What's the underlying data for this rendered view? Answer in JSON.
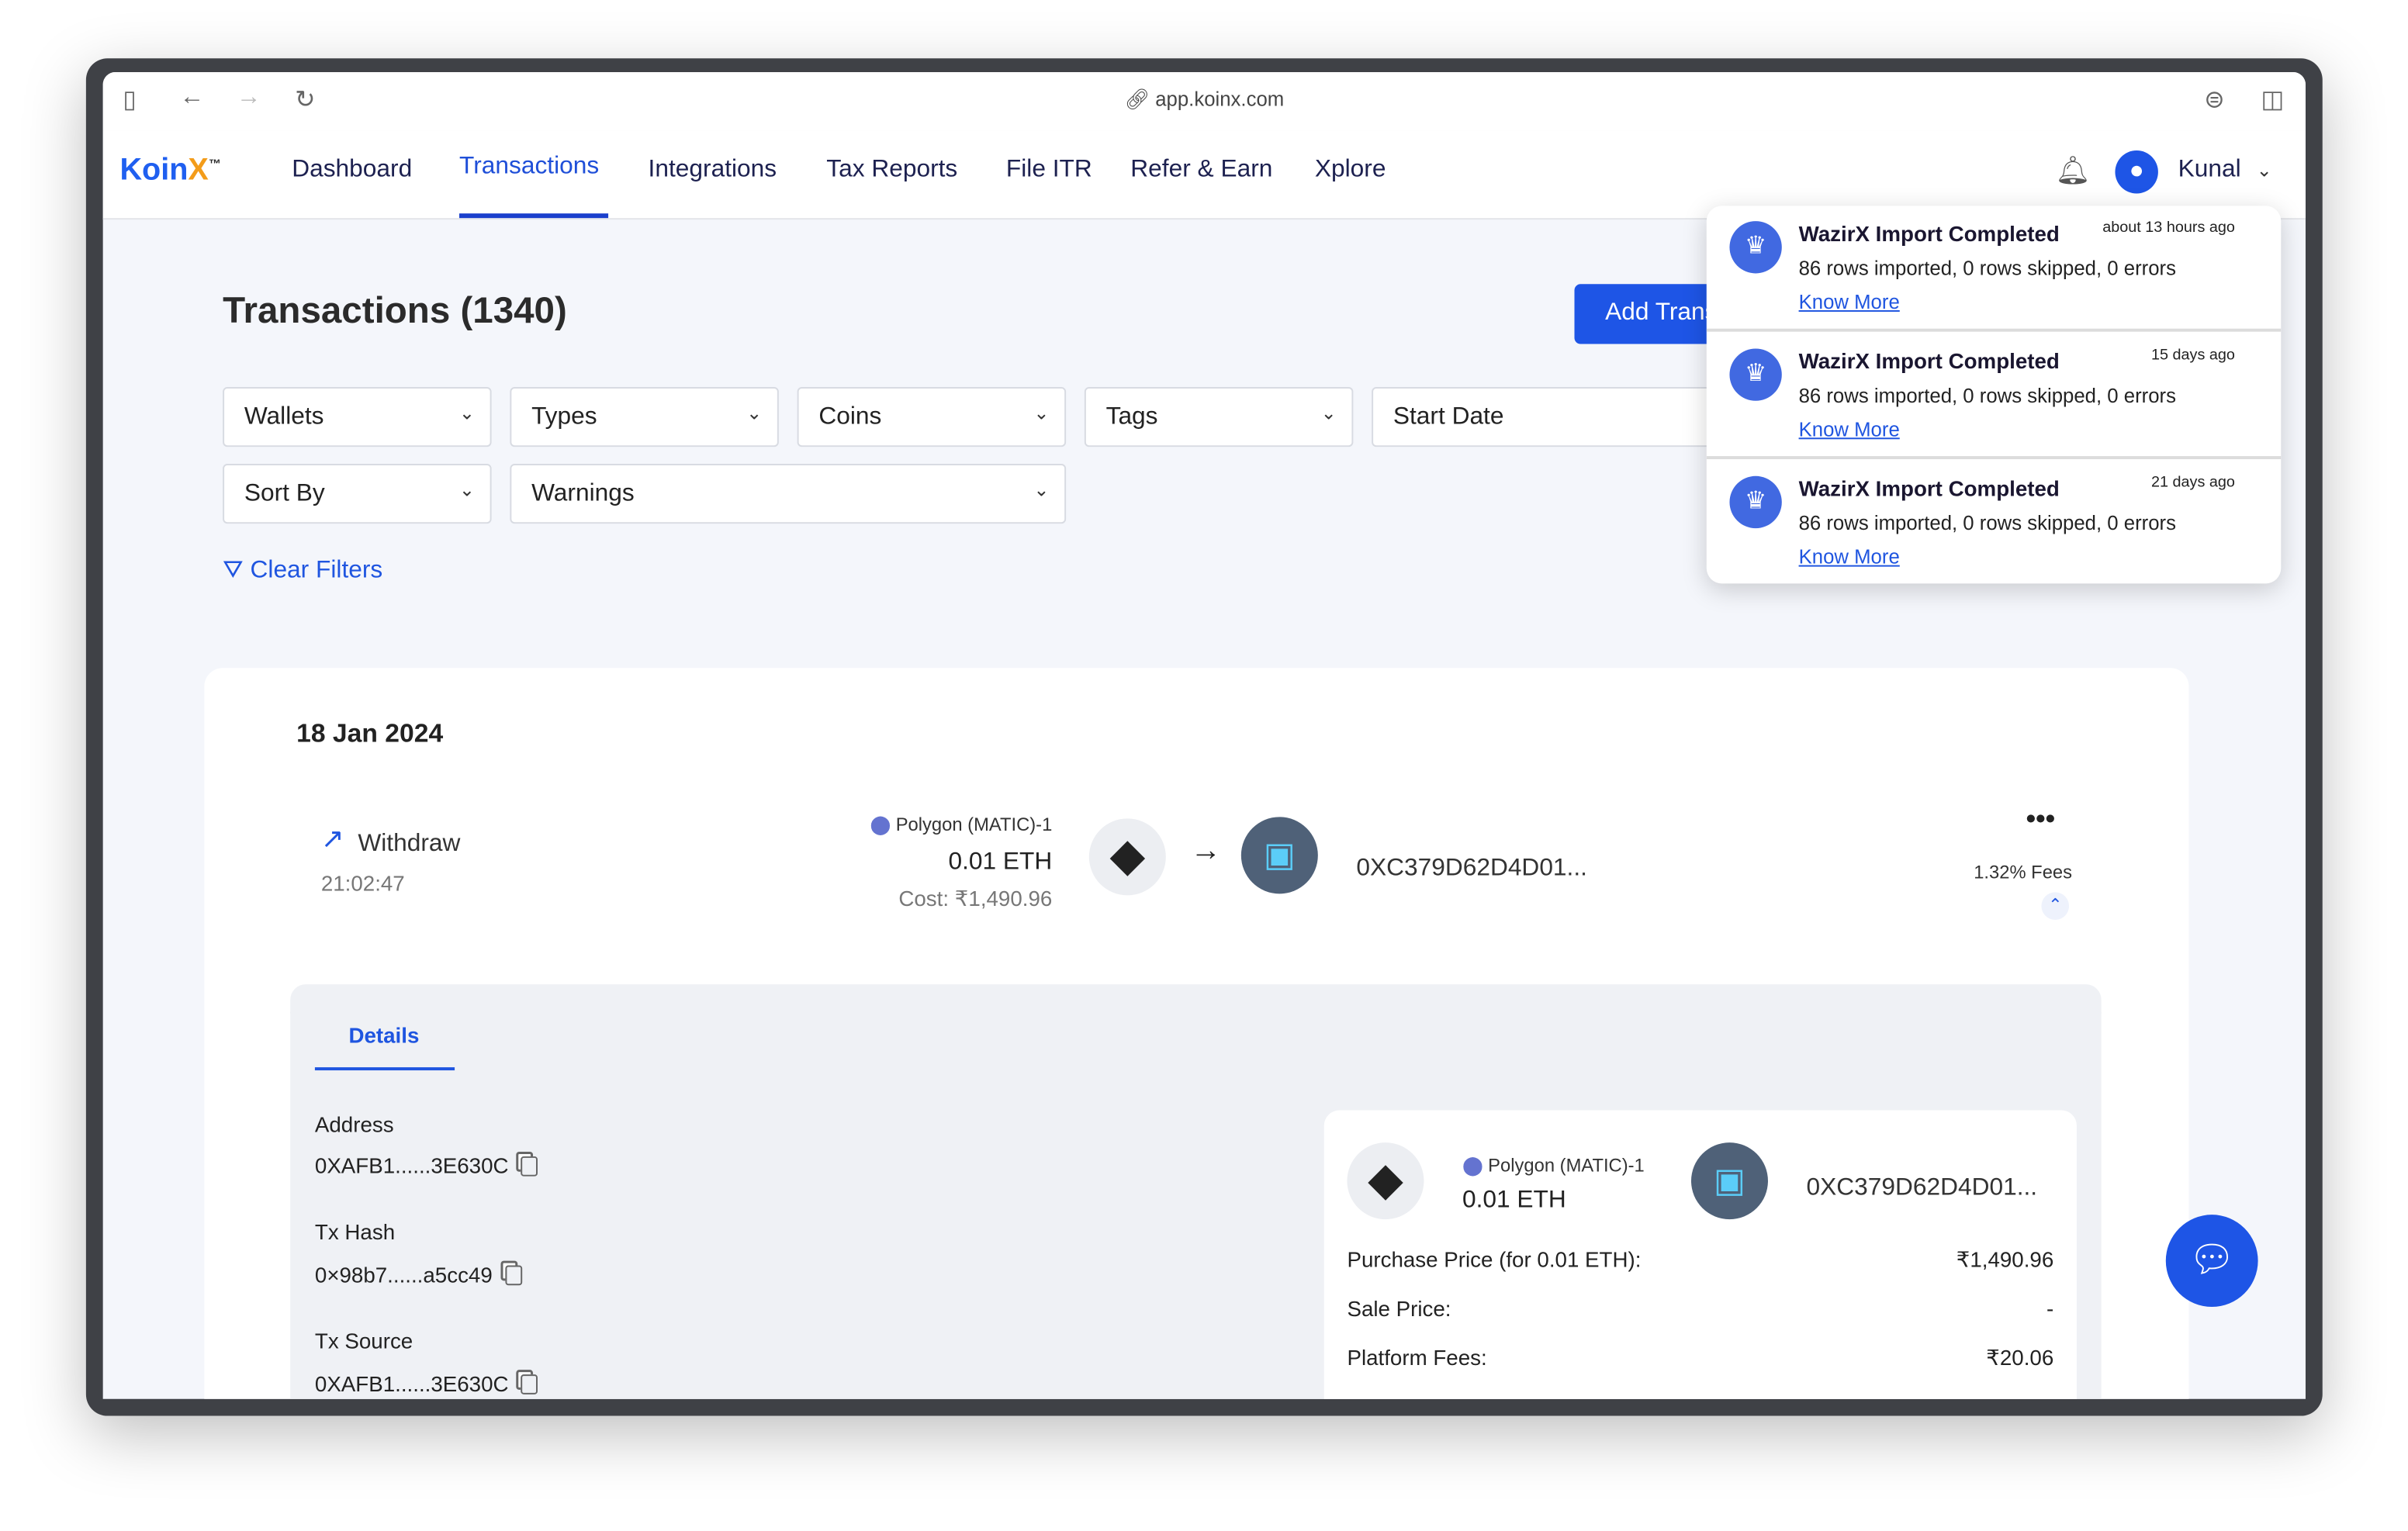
{
  "browser": {
    "url": "app.koinx.com"
  },
  "brand": {
    "logo_text": "Koin",
    "logo_x": "X",
    "logo_tm": "™",
    "primary": "#1e55e6"
  },
  "nav": {
    "items": [
      {
        "label": "Dashboard"
      },
      {
        "label": "Transactions"
      },
      {
        "label": "Integrations"
      },
      {
        "label": "Tax Reports"
      },
      {
        "label": "File ITR"
      },
      {
        "label": "Refer & Earn"
      },
      {
        "label": "Xplore"
      }
    ],
    "active": "Transactions",
    "user": "Kunal"
  },
  "page": {
    "title": "Transactions (1340)",
    "add_button": "Add Transaction"
  },
  "filters": {
    "row1": [
      "Wallets",
      "Types",
      "Coins",
      "Tags"
    ],
    "start_date": "Start Date",
    "row2": [
      "Sort By",
      "Warnings"
    ],
    "clear": "Clear Filters"
  },
  "transaction": {
    "date": "18 Jan 2024",
    "type": "Withdraw",
    "time": "21:02:47",
    "network": "Polygon (MATIC)-1",
    "amount": "0.01 ETH",
    "cost": "Cost: ₹1,490.96",
    "to_address": "0XC379D62D4D01...",
    "fees": "1.32% Fees"
  },
  "details": {
    "tab": "Details",
    "fields": [
      {
        "label": "Address",
        "value": "0XAFB1......3E630C"
      },
      {
        "label": "Tx Hash",
        "value": "0×98b7......a5cc49"
      },
      {
        "label": "Tx Source",
        "value": "0XAFB1......3E630C"
      }
    ],
    "summary": {
      "network": "Polygon (MATIC)-1",
      "amount": "0.01 ETH",
      "to_address": "0XC379D62D4D01...",
      "rows": [
        {
          "label": "Purchase Price (for 0.01 ETH):",
          "value": "₹1,490.96"
        },
        {
          "label": "Sale Price:",
          "value": "-"
        },
        {
          "label": "Platform Fees:",
          "value": "₹20.06"
        }
      ]
    }
  },
  "notifications": [
    {
      "title": "WazirX Import Completed",
      "time": "about 13 hours ago",
      "body": "86 rows imported, 0 rows skipped, 0 errors",
      "link": "Know More"
    },
    {
      "title": "WazirX Import Completed",
      "time": "15 days ago",
      "body": "86 rows imported, 0 rows skipped, 0 errors",
      "link": "Know More"
    },
    {
      "title": "WazirX Import Completed",
      "time": "21 days ago",
      "body": "86 rows imported, 0 rows skipped, 0 errors",
      "link": "Know More"
    }
  ]
}
